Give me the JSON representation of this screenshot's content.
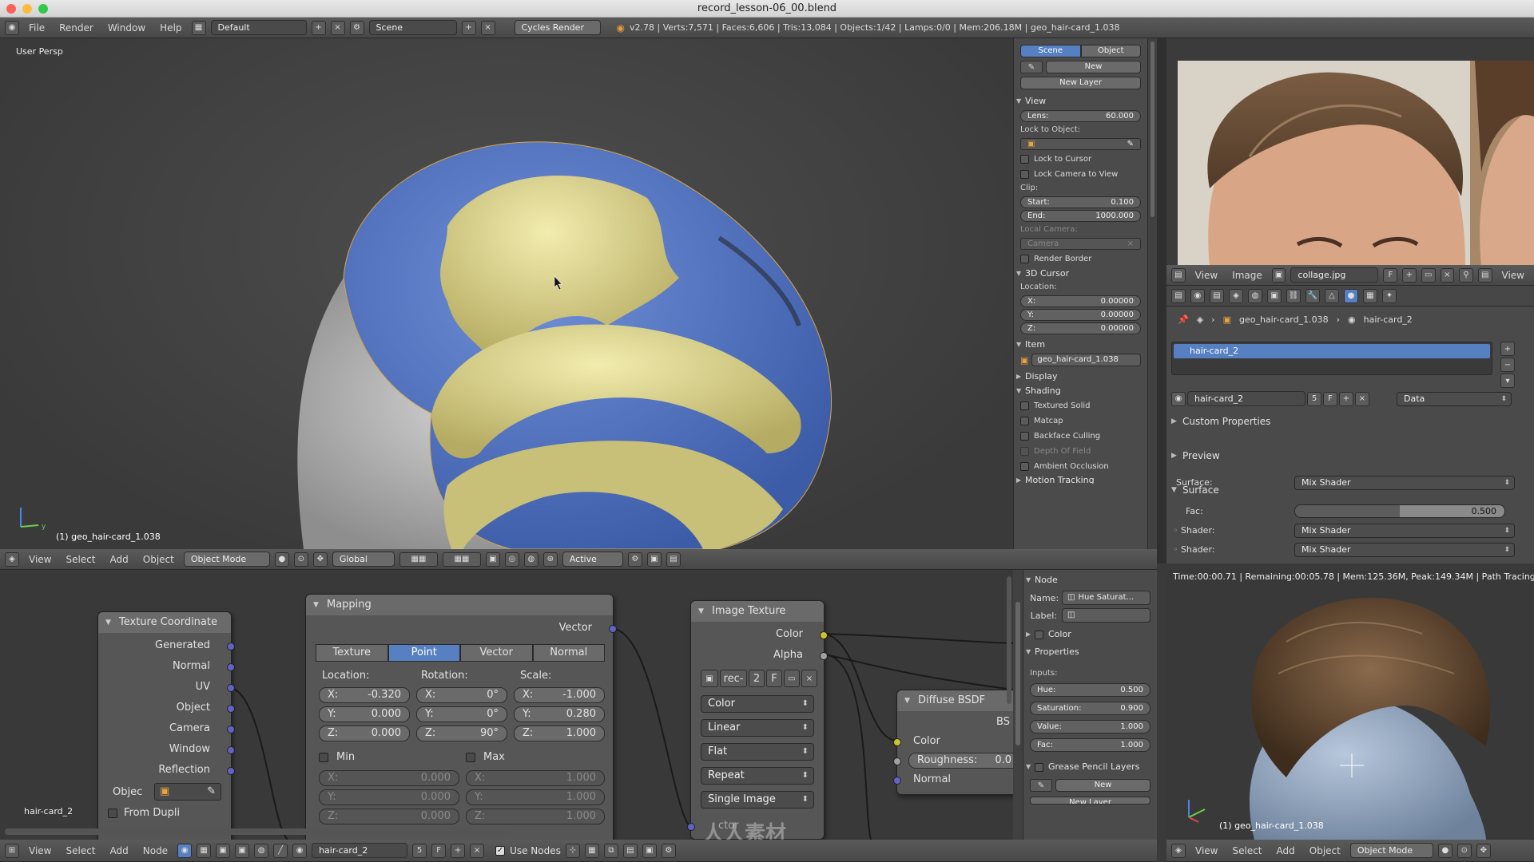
{
  "titlebar": {
    "title": "record_lesson-06_00.blend"
  },
  "info_header": {
    "menus": [
      "File",
      "Render",
      "Window",
      "Help"
    ],
    "layout": "Default",
    "scene": "Scene",
    "engine": "Cycles Render",
    "stats": "v2.78 | Verts:7,571 | Faces:6,606 | Tris:13,084 | Objects:1/42 | Lamps:0/0 | Mem:206.18M | geo_hair-card_1.038"
  },
  "viewport": {
    "view_label": "User Persp",
    "object_label": "(1) geo_hair-card_1.038",
    "header": {
      "menus": [
        "View",
        "Select",
        "Add",
        "Object"
      ],
      "mode": "Object Mode",
      "orientation": "Global",
      "pivot": "Active"
    }
  },
  "npanel": {
    "tabs": [
      "Scene",
      "Object"
    ],
    "new_label": "New",
    "new_layer_label": "New Layer",
    "view_title": "View",
    "lens_label": "Lens:",
    "lens_value": "60.000",
    "lock_to_object": "Lock to Object:",
    "lock_to_cursor": "Lock to Cursor",
    "lock_camera": "Lock Camera to View",
    "clip_label": "Clip:",
    "clip_start_label": "Start:",
    "clip_start": "0.100",
    "clip_end_label": "End:",
    "clip_end": "1000.000",
    "local_camera": "Local Camera:",
    "camera_field": "Camera",
    "render_border": "Render Border",
    "cursor_title": "3D Cursor",
    "location_label": "Location:",
    "cursor": [
      {
        "axis": "X:",
        "value": "0.00000"
      },
      {
        "axis": "Y:",
        "value": "0.00000"
      },
      {
        "axis": "Z:",
        "value": "0.00000"
      }
    ],
    "item_title": "Item",
    "item_name": "geo_hair-card_1.038",
    "display_title": "Display",
    "shading_title": "Shading",
    "shading_opts": [
      "Textured Solid",
      "Matcap",
      "Backface Culling",
      "Depth Of Field",
      "Ambient Occlusion"
    ],
    "motion_tracking": "Motion Tracking"
  },
  "image_editor": {
    "menus": [
      "View",
      "Image"
    ],
    "image_name": "collage.jpg",
    "flag": "F",
    "view_menu": "View"
  },
  "properties": {
    "breadcrumb_obj": "geo_hair-card_1.038",
    "breadcrumb_mat": "hair-card_2",
    "slot_name": "hair-card_2",
    "material_name": "hair-card_2",
    "users": "5",
    "flag": "F",
    "data_dd": "Data",
    "custom_props": "Custom Properties",
    "preview": "Preview",
    "surface_title": "Surface",
    "surface_label": "Surface:",
    "surface_value": "Mix Shader",
    "fac_label": "Fac:",
    "fac_value": "0.500",
    "fac_level": 0.5,
    "shader_label": "Shader:",
    "shader1": "Mix Shader",
    "shader2": "Mix Shader"
  },
  "node_editor": {
    "material_label": "hair-card_2",
    "tex_coord": {
      "title": "Texture Coordinate",
      "outputs": [
        "Generated",
        "Normal",
        "UV",
        "Object",
        "Camera",
        "Window",
        "Reflection"
      ],
      "object_label": "Objec",
      "from_dupli": "From Dupli"
    },
    "mapping": {
      "title": "Mapping",
      "output": "Vector",
      "tabs": [
        "Texture",
        "Point",
        "Vector",
        "Normal"
      ],
      "active_tab": "Point",
      "location_label": "Location:",
      "rotation_label": "Rotation:",
      "scale_label": "Scale:",
      "location": [
        {
          "a": "X:",
          "v": "-0.320"
        },
        {
          "a": "Y:",
          "v": "0.000"
        },
        {
          "a": "Z:",
          "v": "0.000"
        }
      ],
      "rotation": [
        {
          "a": "X:",
          "v": "0°"
        },
        {
          "a": "Y:",
          "v": "0°"
        },
        {
          "a": "Z:",
          "v": "90°"
        }
      ],
      "scale": [
        {
          "a": "X:",
          "v": "-1.000"
        },
        {
          "a": "Y:",
          "v": "0.280"
        },
        {
          "a": "Z:",
          "v": "1.000"
        }
      ],
      "min_label": "Min",
      "max_label": "Max",
      "min": [
        {
          "a": "X:",
          "v": "0.000"
        },
        {
          "a": "Y:",
          "v": "0.000"
        },
        {
          "a": "Z:",
          "v": "0.000"
        }
      ],
      "max": [
        {
          "a": "X:",
          "v": "1.000"
        },
        {
          "a": "Y:",
          "v": "1.000"
        },
        {
          "a": "Z:",
          "v": "1.000"
        }
      ]
    },
    "image_texture": {
      "title": "Image Texture",
      "outputs": [
        "Color",
        "Alpha"
      ],
      "image_name": "rec-",
      "users": "2",
      "flag": "F",
      "options": [
        "Color",
        "Linear",
        "Flat",
        "Repeat",
        "Single Image"
      ],
      "input_partial": "ctor"
    },
    "diffuse": {
      "title": "Diffuse BSDF",
      "output_partial": "BS",
      "inputs": [
        "Color",
        "Normal"
      ],
      "roughness_label": "Roughness:",
      "roughness_value": "0.0"
    },
    "header": {
      "menus": [
        "View",
        "Select",
        "Add",
        "Node"
      ],
      "material": "hair-card_2",
      "users": "5",
      "flag": "F",
      "use_nodes": "Use Nodes"
    }
  },
  "node_panel": {
    "node_title": "Node",
    "name_label": "Name:",
    "name_value": "Hue Saturat...",
    "label_label": "Label:",
    "color_title": "Color",
    "properties_title": "Properties",
    "inputs_label": "Inputs:",
    "inputs": [
      {
        "k": "Hue:",
        "v": "0.500"
      },
      {
        "k": "Saturation:",
        "v": "0.900"
      },
      {
        "k": "Value:",
        "v": "1.000"
      },
      {
        "k": "Fac:",
        "v": "1.000"
      }
    ],
    "grease_title": "Grease Pencil Layers",
    "new_label": "New",
    "new_layer_label": "New Layer"
  },
  "render_view": {
    "status": "Time:00:00.71 | Remaining:00:05.78 | Mem:125.36M, Peak:149.34M | Path Tracing Samp",
    "object_label": "(1) geo_hair-card_1.038",
    "header": {
      "menus": [
        "View",
        "Select",
        "Add",
        "Object"
      ],
      "mode": "Object Mode"
    }
  },
  "watermark": "人人素材"
}
